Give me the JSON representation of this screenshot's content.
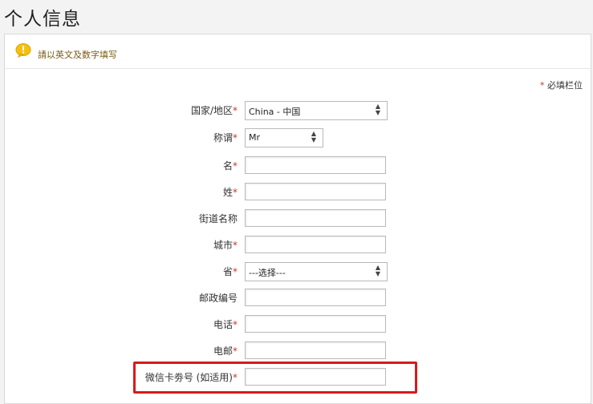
{
  "page": {
    "title": "个人信息"
  },
  "notice": {
    "text": "請以英文及数字填写",
    "icon": "info-bubble-icon"
  },
  "required_note": {
    "star": "*",
    "text": "必填栏位"
  },
  "form": {
    "country": {
      "label": "国家/地区",
      "required": "*",
      "value": "China - 中国"
    },
    "salutation": {
      "label": "称谓",
      "required": "*",
      "value": "Mr"
    },
    "first_name": {
      "label": "名",
      "required": "*",
      "value": ""
    },
    "last_name": {
      "label": "姓",
      "required": "*",
      "value": ""
    },
    "street": {
      "label": "街道名称",
      "required": "",
      "value": ""
    },
    "city": {
      "label": "城市",
      "required": "*",
      "value": ""
    },
    "province": {
      "label": "省",
      "required": "*",
      "value": "---选择---"
    },
    "postal_code": {
      "label": "邮政编号",
      "required": "",
      "value": ""
    },
    "phone": {
      "label": "电话",
      "required": "*",
      "value": ""
    },
    "email": {
      "label": "电邮",
      "required": "*",
      "value": ""
    },
    "wechat_coupon": {
      "label": "微信卡劵号 (如适用)",
      "required": "*",
      "value": ""
    }
  },
  "colors": {
    "highlight": "#d9191d",
    "required_star": "#c0392b",
    "notice_text": "#7a5a12"
  }
}
